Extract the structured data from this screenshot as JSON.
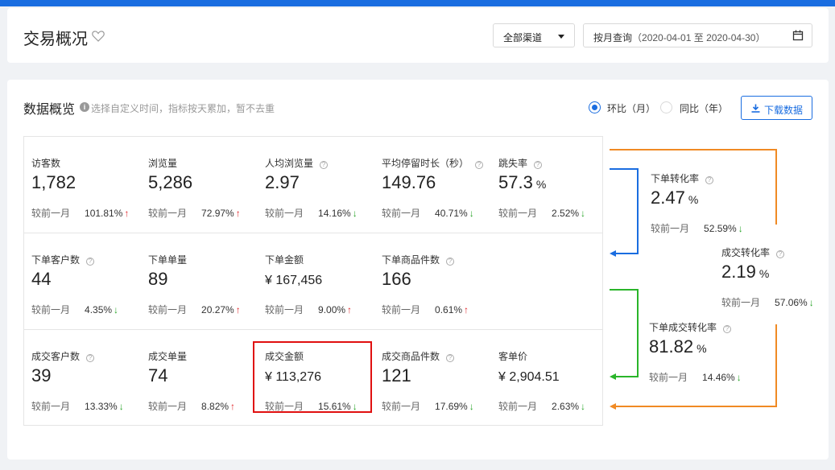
{
  "header": {
    "title": "交易概况",
    "channel_select": "全部渠道",
    "date_query_label": "按月查询",
    "date_range": "（2020-04-01 至 2020-04-30）"
  },
  "overview": {
    "title": "数据概览",
    "hint": "选择自定义时间，指标按天累加，暂不去重",
    "radio_mom": "环比（月）",
    "radio_yoy": "同比（年）",
    "download": "下载数据",
    "compare_label": "较前一月"
  },
  "metrics": [
    {
      "label": "访客数",
      "value": "1,782",
      "pct": "101.81%",
      "trend": "up",
      "help": false
    },
    {
      "label": "浏览量",
      "value": "5,286",
      "pct": "72.97%",
      "trend": "up",
      "help": false
    },
    {
      "label": "人均浏览量",
      "value": "2.97",
      "pct": "14.16%",
      "trend": "down",
      "help": true
    },
    {
      "label": "平均停留时长（秒）",
      "value": "149.76",
      "pct": "40.71%",
      "trend": "down",
      "help": true
    },
    {
      "label": "跳失率",
      "value": "57.3",
      "unit": "%",
      "pct": "2.52%",
      "trend": "down",
      "help": true
    },
    {
      "label": "下单客户数",
      "value": "44",
      "pct": "4.35%",
      "trend": "down",
      "help": true
    },
    {
      "label": "下单单量",
      "value": "89",
      "pct": "20.27%",
      "trend": "up",
      "help": false
    },
    {
      "label": "下单金额",
      "value": "¥ 167,456",
      "pct": "9.00%",
      "trend": "up",
      "help": false
    },
    {
      "label": "下单商品件数",
      "value": "166",
      "pct": "0.61%",
      "trend": "up",
      "help": true
    },
    {
      "label": "成交客户数",
      "value": "39",
      "pct": "13.33%",
      "trend": "down",
      "help": true
    },
    {
      "label": "成交单量",
      "value": "74",
      "pct": "8.82%",
      "trend": "up",
      "help": false
    },
    {
      "label": "成交金额",
      "value": "¥ 113,276",
      "pct": "15.61%",
      "trend": "down",
      "help": false
    },
    {
      "label": "成交商品件数",
      "value": "121",
      "pct": "17.69%",
      "trend": "down",
      "help": true
    },
    {
      "label": "客单价",
      "value": "¥ 2,904.51",
      "pct": "2.63%",
      "trend": "down",
      "help": false
    }
  ],
  "conversions": [
    {
      "label": "下单转化率",
      "value": "2.47",
      "unit": "%",
      "pct": "52.59%",
      "trend": "down"
    },
    {
      "label": "成交转化率",
      "value": "2.19",
      "unit": "%",
      "pct": "57.06%",
      "trend": "down"
    },
    {
      "label": "下单成交转化率",
      "value": "81.82",
      "unit": "%",
      "pct": "14.46%",
      "trend": "down"
    }
  ],
  "colors": {
    "brand": "#1a6de0",
    "up": "#e0262b",
    "down": "#2aa52a",
    "orange": "#f08a24",
    "green": "#2ab52a",
    "highlight": "#e01010"
  },
  "arrows": {
    "up": "↑",
    "down": "↓"
  }
}
